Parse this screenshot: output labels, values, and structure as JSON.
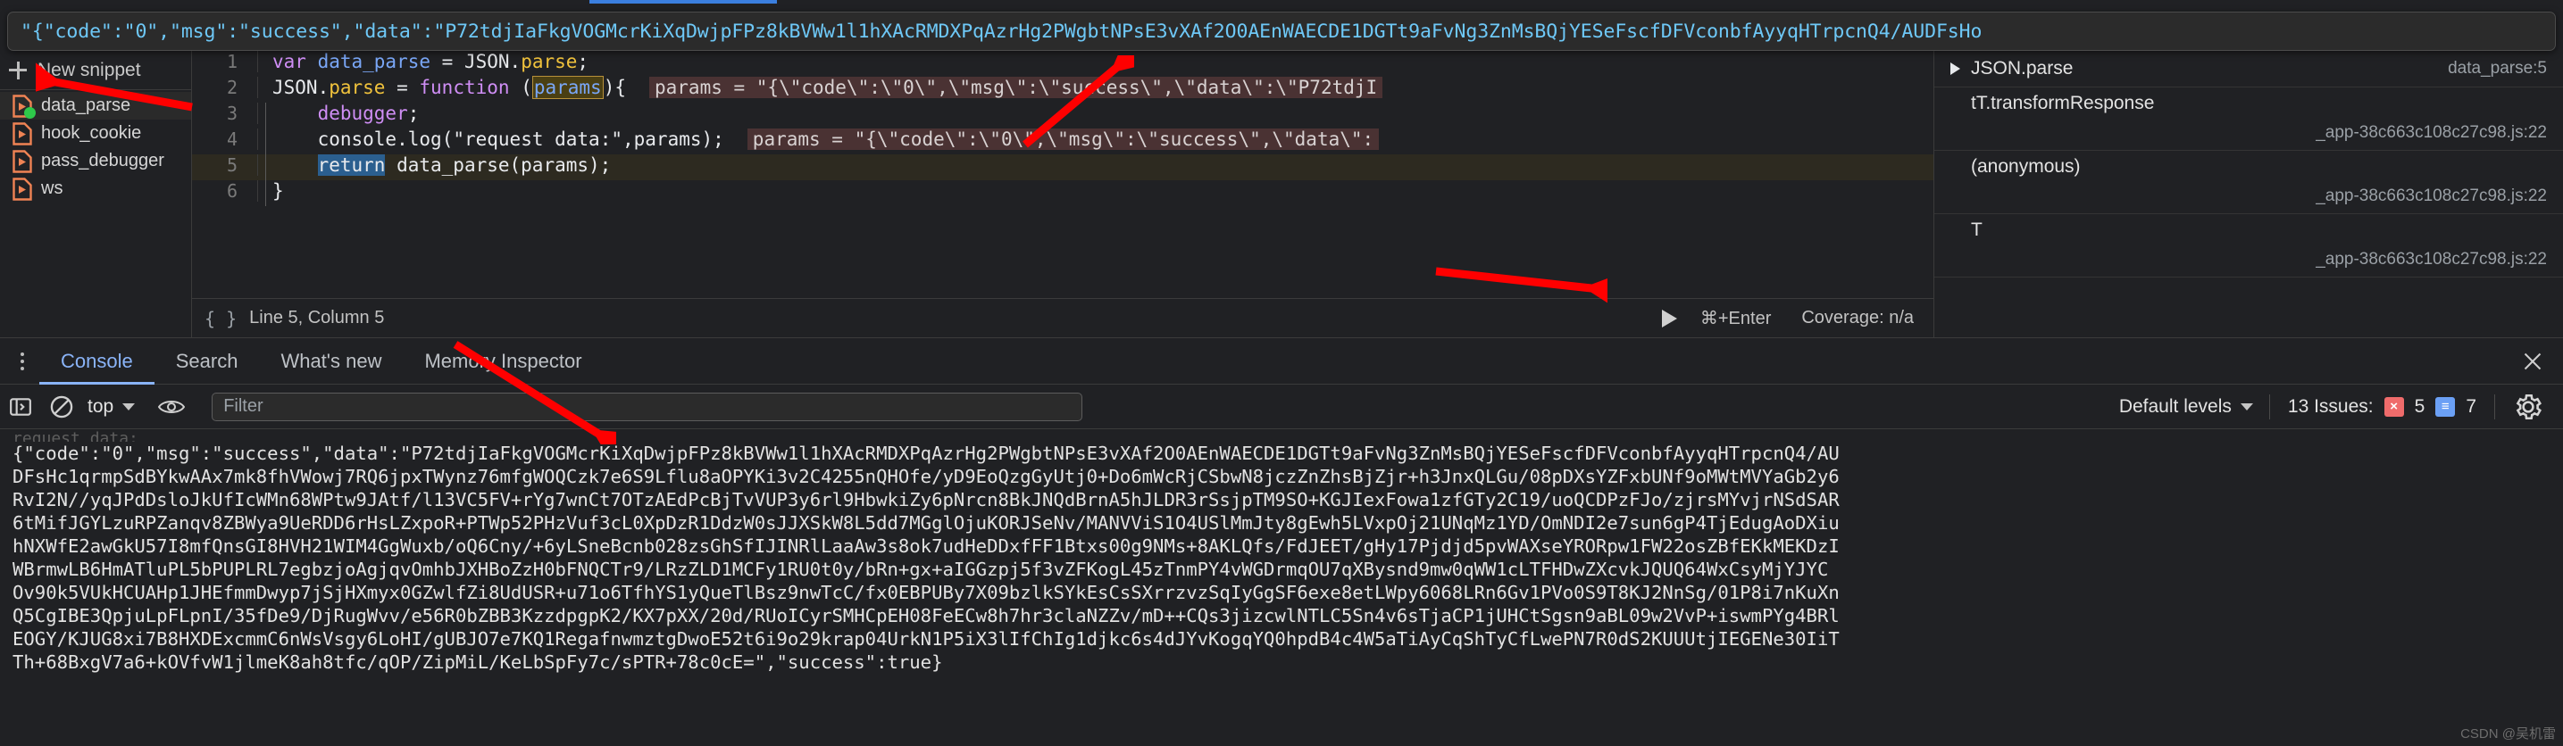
{
  "tooltip": {
    "text": "\"{\"code\":\"0\",\"msg\":\"success\",\"data\":\"P72tdjIaFkgVOGMcrKiXqDwjpFPz8kBVWw1l1hXAcRMDXPqAzrHg2PWgbtNPsE3vXAf2O0AEnWAECDE1DGTt9aFvNg3ZnMsBQjYESeFscfDFVconbfAyyqHTrpcnQ4/AUDFsHo"
  },
  "snippets": {
    "new_label": "New snippet",
    "items": [
      {
        "name": "data_parse",
        "running": true
      },
      {
        "name": "hook_cookie",
        "running": false
      },
      {
        "name": "pass_debugger",
        "running": false
      },
      {
        "name": "ws",
        "running": false
      }
    ]
  },
  "editor": {
    "lines": [
      {
        "n": "1",
        "tokens": [
          {
            "t": "var ",
            "c": "kw"
          },
          {
            "t": "data_parse",
            "c": "var"
          },
          {
            "t": " = ",
            "c": "plain"
          },
          {
            "t": "JSON",
            "c": "plain"
          },
          {
            "t": ".",
            "c": "plain"
          },
          {
            "t": "parse",
            "c": "yel"
          },
          {
            "t": ";",
            "c": "plain"
          }
        ]
      },
      {
        "n": "2",
        "tokens": [
          {
            "t": "JSON",
            "c": "plain"
          },
          {
            "t": ".",
            "c": "plain"
          },
          {
            "t": "parse",
            "c": "yel"
          },
          {
            "t": " = ",
            "c": "plain"
          },
          {
            "t": "function ",
            "c": "kw"
          },
          {
            "t": "(",
            "c": "plain"
          },
          {
            "t": "params",
            "c": "param-box"
          },
          {
            "t": "){",
            "c": "plain"
          }
        ],
        "hint": "params = \"{\\\"code\\\":\\\"0\\\",\\\"msg\\\":\\\"success\\\",\\\"data\\\":\\\"P72tdjI"
      },
      {
        "n": "3",
        "tokens": [
          {
            "t": "    ",
            "c": "plain"
          },
          {
            "t": "debugger",
            "c": "kw"
          },
          {
            "t": ";",
            "c": "plain"
          }
        ]
      },
      {
        "n": "4",
        "tokens": [
          {
            "t": "    ",
            "c": "plain"
          },
          {
            "t": "console",
            "c": "plain"
          },
          {
            "t": ".",
            "c": "plain"
          },
          {
            "t": "log",
            "c": "plain"
          },
          {
            "t": "(",
            "c": "plain"
          },
          {
            "t": "\"request data:\"",
            "c": "plain"
          },
          {
            "t": ",params);",
            "c": "plain"
          }
        ],
        "hint": "params = \"{\\\"code\\\":\\\"0\\\",\\\"msg\\\":\\\"success\\\",\\\"data\\\":"
      },
      {
        "n": "5",
        "tokens": [
          {
            "t": "    ",
            "c": "plain"
          },
          {
            "t": "return",
            "c": "sel-ret"
          },
          {
            "t": " data_parse(params);",
            "c": "plain"
          }
        ],
        "highlight": true
      },
      {
        "n": "6",
        "tokens": [
          {
            "t": "}",
            "c": "plain"
          }
        ]
      }
    ],
    "status": {
      "braces": "{ }",
      "position": "Line 5, Column 5",
      "run_shortcut": "⌘+Enter",
      "coverage": "Coverage: n/a"
    }
  },
  "callstack": {
    "rows": [
      {
        "name": "JSON.parse",
        "source": "data_parse:5",
        "arrow": true
      },
      {
        "name": "tT.transformResponse",
        "source": "_app-38c663c108c27c98.js:22",
        "arrow": false
      },
      {
        "name": "(anonymous)",
        "source": "_app-38c663c108c27c98.js:22",
        "arrow": false
      },
      {
        "name": "T",
        "source": "_app-38c663c108c27c98.js:22",
        "arrow": false
      }
    ]
  },
  "tabs": [
    {
      "label": "Console",
      "active": true
    },
    {
      "label": "Search",
      "active": false
    },
    {
      "label": "What's new",
      "active": false
    },
    {
      "label": "Memory Inspector",
      "active": false
    }
  ],
  "filterbar": {
    "context": "top",
    "filter_placeholder": "Filter",
    "filter_value": "",
    "levels": "Default levels",
    "issues_label": "13 Issues:",
    "error_count": "5",
    "info_count": "7",
    "error_color": "#ef6b6b",
    "info_color": "#6ba0f5"
  },
  "console_output": {
    "faded_top": "request data:",
    "lines": [
      "{\"code\":\"0\",\"msg\":\"success\",\"data\":\"P72tdjIaFkgVOGMcrKiXqDwjpFPz8kBVWw1l1hXAcRMDXPqAzrHg2PWgbtNPsE3vXAf2O0AEnWAECDE1DGTt9aFvNg3ZnMsBQjYESeFscfDFVconbfAyyqHTrpcnQ4/AU",
      "DFsHc1qrmpSdBYkwAAx7mk8fhVWowj7RQ6jpxTWynz76mfgWOQCzk7e6S9Lflu8aOPYKi3v2C4255nQHOfe/yD9EoQzgGyUtj0+Do6mWcRjCSbwN8jczZnZhsBjZjr+h3JnxQLGu/08pDXsYZFxbUNf9oMWtMVYaGb2y6",
      "RvI2N//yqJPdDsloJkUfIcWMn68WPtw9JAtf/l13VC5FV+rYg7wnCt7OTzAEdPcBjTvVUP3y6rl9HbwkiZy6pNrcn8BkJNQdBrnA5hJLDR3rSsjpTM9SO+KGJIexFowa1zfGTy2C19/uoQCDPzFJo/zjrsMYvjrNSdSAR",
      "6tMifJGYLzuRPZanqv8ZBWya9UeRDD6rHsLZxpoR+PTWp52PHzVuf3cL0XpDzR1DdzW0sJJXSkW8L5dd7MGglOjuKORJSeNv/MANVViS1O4USlMmJty8gEwh5LVxpOj21UNqMz1YD/OmNDI2e7sun6gP4TjEdugAoDXiu",
      "hNXWfE2awGkU57I8mfQnsGI8HVH21WIM4GgWuxb/oQ6Cny/+6yLSneBcnb028zsGhSfIJINRlLaaAw3s8ok7udHeDDxfFF1Btxs00g9NMs+8AKLQfs/FdJEET/gHy17Pjdjd5pvWAXseYRORpw1FW22osZBfEKkMEKDzI",
      "WBrmwLB6HmATluPL5bPUPLRL7egbzjoAgjqvOmhbJXHBoZzH0bFNQCTr9/LRzZLD1MCFy1RU0t0y/bRn+gx+aIGGzpj5f3vZFKogL45zTnmPY4vWGDrmqOU7qXBysnd9mw0qWW1cLTFHDwZXcvkJQUQ64WxCsyMjYJYC",
      "Ov90k5VUkHCUAHp1JHEfmmDwyp7jSjHXmyx0GZwlfZi8UdUSR+u71o6TfhYS1yQueTlBsz9nwTcC/fx0EBPUBy7X09bzlkSYkEsCsSXrrzvzSqIyGgSF6exe8etLWpy6068LRn6Gv1PVo0S9T8KJ2NnSg/01P8i7nKuXn",
      "Q5CgIBE3QpjuLpFLpnI/35fDe9/DjRugWvv/e56R0bZBB3KzzdpgpK2/KX7pXX/20d/RUoICyrSMHCpEH08FeECw8h7hr3claNZZv/mD++CQs3jizcwlNTLC5Sn4v6sTjaCP1jUHCtSgsn9aBL09w2VvP+iswmPYg4BRl",
      "EOGY/KJUG8xi7B8HXDExcmmC6nWsVsgy6LoHI/gUBJO7e7KQ1RegafnwmztgDwoE52t6i9o29krap04UrkN1P5iX3lIfChIg1djkc6s4dJYvKogqYQ0hpdB4c4W5aTiAyCqShTyCfLwePN7R0dS2KUUUtjIEGENe30IiT",
      "Th+68BxgV7a6+kOVfvW1jlmeK8ah8tfc/qOP/ZipMiL/KeLbSpFy7c/sPTR+78c0cE=\",\"success\":true}"
    ]
  },
  "watermark": "CSDN @吴机雷"
}
